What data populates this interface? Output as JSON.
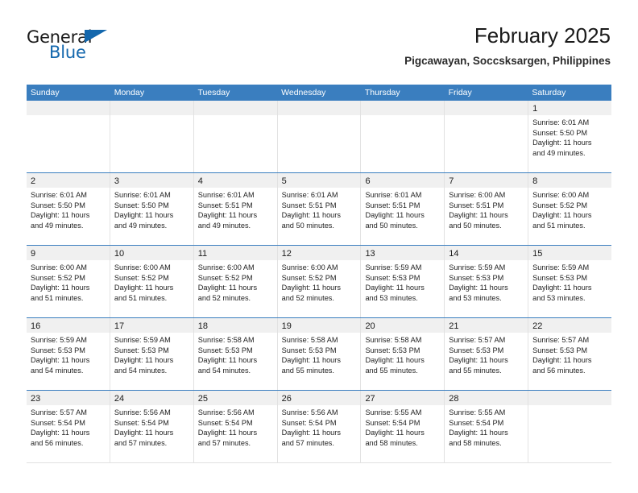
{
  "brand": {
    "name_part1": "General",
    "name_part2": "Blue",
    "accent_color": "#1367ad",
    "logo_icon": "triangle-logo-icon"
  },
  "header": {
    "title": "February 2025",
    "subtitle": "Pigcawayan, Soccsksargen, Philippines"
  },
  "calendar": {
    "header_bg": "#3a7ebf",
    "daynum_bg": "#f0f0f0",
    "weekdays": [
      "Sunday",
      "Monday",
      "Tuesday",
      "Wednesday",
      "Thursday",
      "Friday",
      "Saturday"
    ],
    "weeks": [
      [
        {
          "day": "",
          "empty": true
        },
        {
          "day": "",
          "empty": true
        },
        {
          "day": "",
          "empty": true
        },
        {
          "day": "",
          "empty": true
        },
        {
          "day": "",
          "empty": true
        },
        {
          "day": "",
          "empty": true
        },
        {
          "day": "1",
          "sunrise": "Sunrise: 6:01 AM",
          "sunset": "Sunset: 5:50 PM",
          "daylight1": "Daylight: 11 hours",
          "daylight2": "and 49 minutes."
        }
      ],
      [
        {
          "day": "2",
          "sunrise": "Sunrise: 6:01 AM",
          "sunset": "Sunset: 5:50 PM",
          "daylight1": "Daylight: 11 hours",
          "daylight2": "and 49 minutes."
        },
        {
          "day": "3",
          "sunrise": "Sunrise: 6:01 AM",
          "sunset": "Sunset: 5:50 PM",
          "daylight1": "Daylight: 11 hours",
          "daylight2": "and 49 minutes."
        },
        {
          "day": "4",
          "sunrise": "Sunrise: 6:01 AM",
          "sunset": "Sunset: 5:51 PM",
          "daylight1": "Daylight: 11 hours",
          "daylight2": "and 49 minutes."
        },
        {
          "day": "5",
          "sunrise": "Sunrise: 6:01 AM",
          "sunset": "Sunset: 5:51 PM",
          "daylight1": "Daylight: 11 hours",
          "daylight2": "and 50 minutes."
        },
        {
          "day": "6",
          "sunrise": "Sunrise: 6:01 AM",
          "sunset": "Sunset: 5:51 PM",
          "daylight1": "Daylight: 11 hours",
          "daylight2": "and 50 minutes."
        },
        {
          "day": "7",
          "sunrise": "Sunrise: 6:00 AM",
          "sunset": "Sunset: 5:51 PM",
          "daylight1": "Daylight: 11 hours",
          "daylight2": "and 50 minutes."
        },
        {
          "day": "8",
          "sunrise": "Sunrise: 6:00 AM",
          "sunset": "Sunset: 5:52 PM",
          "daylight1": "Daylight: 11 hours",
          "daylight2": "and 51 minutes."
        }
      ],
      [
        {
          "day": "9",
          "sunrise": "Sunrise: 6:00 AM",
          "sunset": "Sunset: 5:52 PM",
          "daylight1": "Daylight: 11 hours",
          "daylight2": "and 51 minutes."
        },
        {
          "day": "10",
          "sunrise": "Sunrise: 6:00 AM",
          "sunset": "Sunset: 5:52 PM",
          "daylight1": "Daylight: 11 hours",
          "daylight2": "and 51 minutes."
        },
        {
          "day": "11",
          "sunrise": "Sunrise: 6:00 AM",
          "sunset": "Sunset: 5:52 PM",
          "daylight1": "Daylight: 11 hours",
          "daylight2": "and 52 minutes."
        },
        {
          "day": "12",
          "sunrise": "Sunrise: 6:00 AM",
          "sunset": "Sunset: 5:52 PM",
          "daylight1": "Daylight: 11 hours",
          "daylight2": "and 52 minutes."
        },
        {
          "day": "13",
          "sunrise": "Sunrise: 5:59 AM",
          "sunset": "Sunset: 5:53 PM",
          "daylight1": "Daylight: 11 hours",
          "daylight2": "and 53 minutes."
        },
        {
          "day": "14",
          "sunrise": "Sunrise: 5:59 AM",
          "sunset": "Sunset: 5:53 PM",
          "daylight1": "Daylight: 11 hours",
          "daylight2": "and 53 minutes."
        },
        {
          "day": "15",
          "sunrise": "Sunrise: 5:59 AM",
          "sunset": "Sunset: 5:53 PM",
          "daylight1": "Daylight: 11 hours",
          "daylight2": "and 53 minutes."
        }
      ],
      [
        {
          "day": "16",
          "sunrise": "Sunrise: 5:59 AM",
          "sunset": "Sunset: 5:53 PM",
          "daylight1": "Daylight: 11 hours",
          "daylight2": "and 54 minutes."
        },
        {
          "day": "17",
          "sunrise": "Sunrise: 5:59 AM",
          "sunset": "Sunset: 5:53 PM",
          "daylight1": "Daylight: 11 hours",
          "daylight2": "and 54 minutes."
        },
        {
          "day": "18",
          "sunrise": "Sunrise: 5:58 AM",
          "sunset": "Sunset: 5:53 PM",
          "daylight1": "Daylight: 11 hours",
          "daylight2": "and 54 minutes."
        },
        {
          "day": "19",
          "sunrise": "Sunrise: 5:58 AM",
          "sunset": "Sunset: 5:53 PM",
          "daylight1": "Daylight: 11 hours",
          "daylight2": "and 55 minutes."
        },
        {
          "day": "20",
          "sunrise": "Sunrise: 5:58 AM",
          "sunset": "Sunset: 5:53 PM",
          "daylight1": "Daylight: 11 hours",
          "daylight2": "and 55 minutes."
        },
        {
          "day": "21",
          "sunrise": "Sunrise: 5:57 AM",
          "sunset": "Sunset: 5:53 PM",
          "daylight1": "Daylight: 11 hours",
          "daylight2": "and 55 minutes."
        },
        {
          "day": "22",
          "sunrise": "Sunrise: 5:57 AM",
          "sunset": "Sunset: 5:53 PM",
          "daylight1": "Daylight: 11 hours",
          "daylight2": "and 56 minutes."
        }
      ],
      [
        {
          "day": "23",
          "sunrise": "Sunrise: 5:57 AM",
          "sunset": "Sunset: 5:54 PM",
          "daylight1": "Daylight: 11 hours",
          "daylight2": "and 56 minutes."
        },
        {
          "day": "24",
          "sunrise": "Sunrise: 5:56 AM",
          "sunset": "Sunset: 5:54 PM",
          "daylight1": "Daylight: 11 hours",
          "daylight2": "and 57 minutes."
        },
        {
          "day": "25",
          "sunrise": "Sunrise: 5:56 AM",
          "sunset": "Sunset: 5:54 PM",
          "daylight1": "Daylight: 11 hours",
          "daylight2": "and 57 minutes."
        },
        {
          "day": "26",
          "sunrise": "Sunrise: 5:56 AM",
          "sunset": "Sunset: 5:54 PM",
          "daylight1": "Daylight: 11 hours",
          "daylight2": "and 57 minutes."
        },
        {
          "day": "27",
          "sunrise": "Sunrise: 5:55 AM",
          "sunset": "Sunset: 5:54 PM",
          "daylight1": "Daylight: 11 hours",
          "daylight2": "and 58 minutes."
        },
        {
          "day": "28",
          "sunrise": "Sunrise: 5:55 AM",
          "sunset": "Sunset: 5:54 PM",
          "daylight1": "Daylight: 11 hours",
          "daylight2": "and 58 minutes."
        },
        {
          "day": "",
          "empty": true
        }
      ]
    ]
  }
}
